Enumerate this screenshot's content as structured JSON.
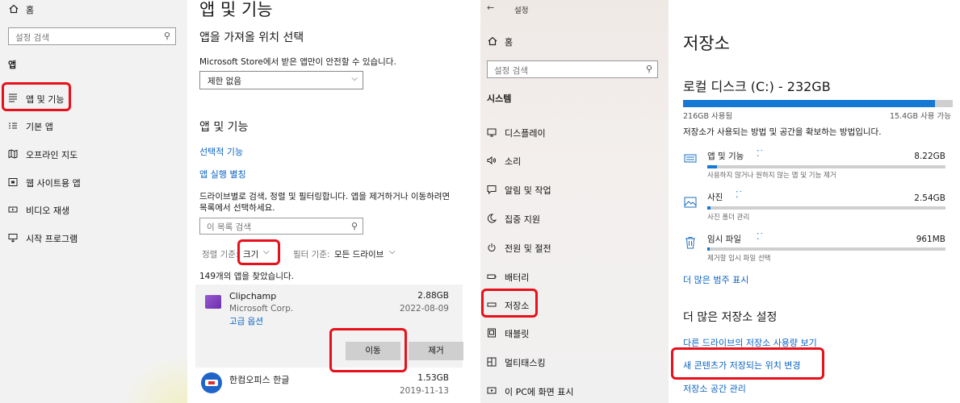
{
  "panel1": {
    "home_label": "홈",
    "search_placeholder": "설정 검색",
    "section_label": "앱",
    "items": [
      {
        "label": "앱 및 기능"
      },
      {
        "label": "기본 앱"
      },
      {
        "label": "오프라인 지도"
      },
      {
        "label": "웹 사이트용 앱"
      },
      {
        "label": "비디오 재생"
      },
      {
        "label": "시작 프로그램"
      }
    ]
  },
  "panel2": {
    "page_title": "앱 및 기능",
    "install_section_title": "앱을 가져올 위치 선택",
    "install_desc": "Microsoft Store에서 받은 앱만이 안전할 수 있습니다.",
    "install_dropdown_value": "제한 없음",
    "apps_section_title": "앱 및 기능",
    "optional_features_link": "선택적 기능",
    "app_aliases_link": "앱 실행 별칭",
    "desc_line1": "드라이브별로 검색, 정렬 및 필터링합니다. 앱을 제거하거나 이동하려면",
    "desc_line2": "목록에서 선택하세요.",
    "list_search_placeholder": "이 목록 검색",
    "sort_label": "정렬 기준:",
    "sort_value": "크기",
    "filter_label": "필터 기준:",
    "filter_value": "모든 드라이브",
    "found_count": "149개의 앱을 찾았습니다.",
    "apps": [
      {
        "name": "Clipchamp",
        "publisher": "Microsoft Corp.",
        "size": "2.88GB",
        "date": "2022-08-09",
        "advanced_link": "고급 옵션"
      },
      {
        "name": "한컴오피스 한글",
        "size": "1.53GB",
        "date": "2019-11-13"
      }
    ],
    "move_button": "이동",
    "uninstall_button": "제거"
  },
  "panel3": {
    "title": "설정",
    "home_label": "홈",
    "search_placeholder": "설정 검색",
    "section_label": "시스템",
    "items": [
      {
        "label": "디스플레이"
      },
      {
        "label": "소리"
      },
      {
        "label": "알림 및 작업"
      },
      {
        "label": "집중 지원"
      },
      {
        "label": "전원 및 절전"
      },
      {
        "label": "배터리"
      },
      {
        "label": "저장소"
      },
      {
        "label": "태블릿"
      },
      {
        "label": "멀티태스킹"
      },
      {
        "label": "이 PC에 화면 표시"
      }
    ]
  },
  "panel4": {
    "page_title": "저장소",
    "disk_title": "로컬 디스크 (C:) - 232GB",
    "used_label": "216GB 사용됨",
    "free_label": "15.4GB 사용 가능",
    "used_fraction": 0.9336,
    "desc": "저장소가 사용되는 방법 및 공간을 확보하는 방법입니다.",
    "categories": [
      {
        "name": "앱 및 기능",
        "size": "8.22GB",
        "sub": "사용하지 않거나 원하지 않는 앱 및 기능 제거",
        "fraction": 0.04
      },
      {
        "name": "사진",
        "size": "2.54GB",
        "sub": "사진 폴더 관리",
        "fraction": 0.012
      },
      {
        "name": "임시 파일",
        "size": "961MB",
        "sub": "제거할 임시 파일 선택",
        "fraction": 0.005
      }
    ],
    "more_categories_link": "더 많은 범주 표시",
    "more_settings_title": "더 많은 저장소 설정",
    "links": [
      {
        "label": "다른 드라이브의 저장소 사용량 보기"
      },
      {
        "label": "새 콘텐츠가 저장되는 위치 변경"
      },
      {
        "label": "저장소 공간 관리"
      }
    ]
  },
  "colors": {
    "accent": "#0a63c2",
    "highlight_box": "#e8101a",
    "bar_fill": "#1478d4"
  }
}
